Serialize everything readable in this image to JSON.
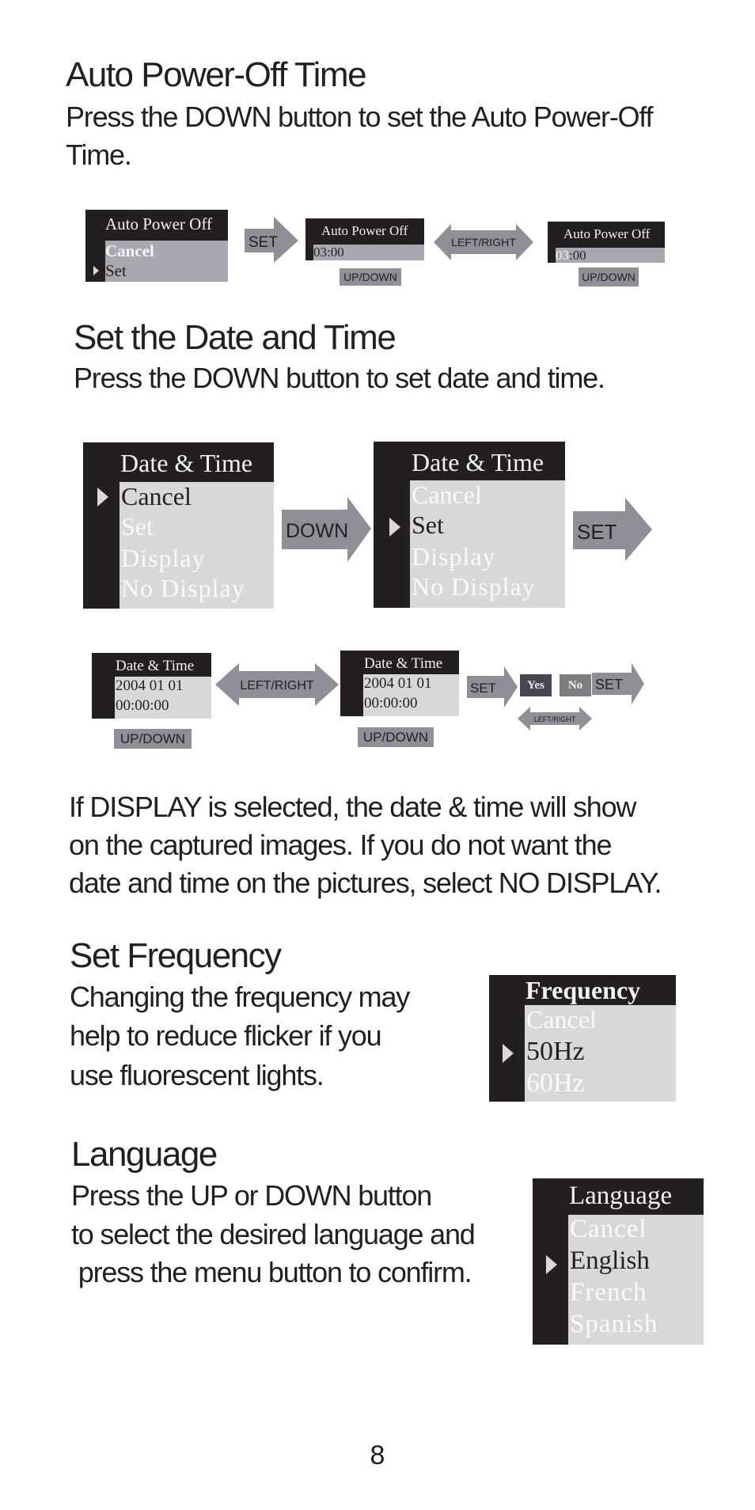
{
  "sections": {
    "auto_power_off": {
      "heading": "Auto Power-Off Time",
      "body_lines": [
        "Press the DOWN button to set the Auto Power-Off",
        "Time."
      ],
      "menu1": {
        "title": "Auto Power Off",
        "items": [
          "Cancel",
          "Set"
        ],
        "selected_index": 1
      },
      "arrow_set": "SET",
      "menu2": {
        "title": "Auto Power Off",
        "value": "03:00",
        "value_highlight": "minutes"
      },
      "updown_label_1": "UP/DOWN",
      "arrow_leftright": "LEFT/RIGHT",
      "menu3": {
        "title": "Auto Power Off",
        "value_hours": "03",
        "value_rest": ":00",
        "value_highlight": "hours"
      },
      "updown_label_2": "UP/DOWN"
    },
    "date_time": {
      "heading": "Set the Date and Time",
      "body": "Press the DOWN button to set date and time.",
      "menu1": {
        "title": "Date & Time",
        "items": [
          "Cancel",
          "Set",
          "Display",
          "No Display"
        ],
        "selected_index": 0
      },
      "arrow_down": "DOWN",
      "menu2": {
        "title": "Date & Time",
        "items": [
          "Cancel",
          "Set",
          "Display",
          "No Display"
        ],
        "selected_index": 1
      },
      "arrow_set": "SET",
      "edit1": {
        "title": "Date & Time",
        "date": "2004 01 01",
        "time": "00:00:00"
      },
      "updown_label_1": "UP/DOWN",
      "arrow_leftright": "LEFT/RIGHT",
      "edit2": {
        "title": "Date & Time",
        "date": "2004 01 01",
        "time": "00:00:00"
      },
      "updown_label_2": "UP/DOWN",
      "arrow_set_2": "SET",
      "confirm": {
        "yes": "Yes",
        "no": "No"
      },
      "arrow_set_3": "SET",
      "arrow_leftright_small": "LEFT/RIGHT",
      "note_lines": [
        "If DISPLAY is selected, the date & time will show",
        "on the captured images.  If you do not want the",
        "date and time on the pictures, select NO DISPLAY."
      ]
    },
    "frequency": {
      "heading": "Set Frequency",
      "body_lines": [
        "Changing the frequency may",
        "help to reduce flicker if you",
        "use fluorescent lights."
      ],
      "menu": {
        "title": "Frequency",
        "items": [
          "Cancel",
          "50Hz",
          "60Hz"
        ],
        "selected_index": 1
      }
    },
    "language": {
      "heading": "Language",
      "body_lines": [
        "Press the UP or DOWN button",
        "to select the desired language and",
        " press the menu button to confirm."
      ],
      "menu": {
        "title": "Language",
        "items": [
          "Cancel",
          "English",
          "French",
          "Spanish"
        ],
        "selected_index": 1
      }
    }
  },
  "page_number": "8",
  "colors": {
    "text": "#231f20",
    "lcd_black": "#231f20",
    "lcd_gray_dark": "#a9a8b0",
    "lcd_gray_light": "#d8d8d8",
    "arrow_gray": "#8f8f98",
    "yes_box": "#464650",
    "no_box": "#7d7d80"
  }
}
